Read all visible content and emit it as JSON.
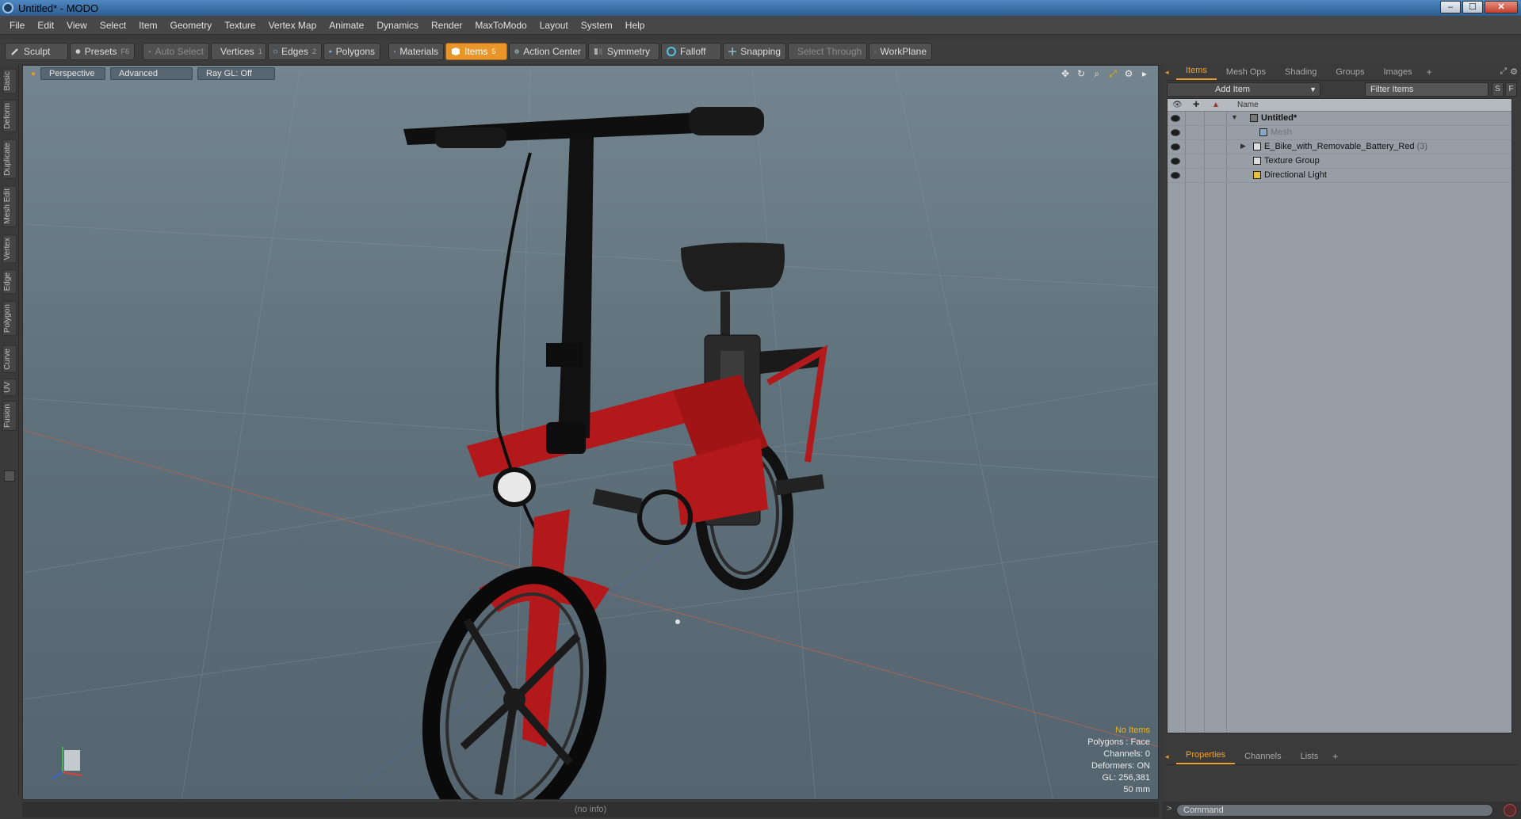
{
  "window": {
    "title": "Untitled* - MODO",
    "min": "–",
    "max": "☐",
    "close": "✕"
  },
  "menu": [
    "File",
    "Edit",
    "View",
    "Select",
    "Item",
    "Geometry",
    "Texture",
    "Vertex Map",
    "Animate",
    "Dynamics",
    "Render",
    "MaxToModo",
    "Layout",
    "System",
    "Help"
  ],
  "toolbar": {
    "sculpt": "Sculpt",
    "presets": "Presets",
    "presets_key": "F6",
    "auto_select": "Auto Select",
    "vertices": "Vertices",
    "vertices_key": "1",
    "edges": "Edges",
    "edges_key": "2",
    "polygons": "Polygons",
    "materials": "Materials",
    "items": "Items",
    "items_key": "5",
    "action_center": "Action Center",
    "symmetry": "Symmetry",
    "falloff": "Falloff",
    "snapping": "Snapping",
    "select_through": "Select Through",
    "workplane": "WorkPlane"
  },
  "left_tabs": [
    "Basic",
    "Deform",
    "Duplicate",
    "Mesh Edit",
    "Vertex",
    "Edge",
    "Polygon",
    "Curve",
    "UV",
    "Fusion"
  ],
  "viewport": {
    "view": "Perspective",
    "mode": "Advanced",
    "raygl": "Ray GL: Off",
    "info": {
      "selection": "No Items",
      "polygons": "Polygons : Face",
      "channels": "Channels: 0",
      "deformers": "Deformers: ON",
      "gl": "GL: 256,381",
      "scale": "50 mm"
    }
  },
  "status": "(no info)",
  "panel_top": {
    "tabs": [
      "Items",
      "Mesh Ops",
      "Shading",
      "Groups",
      "Images"
    ],
    "plus": "+",
    "add_item": "Add Item",
    "filter": "Filter Items",
    "btn_s": "S",
    "btn_f": "F",
    "column_name": "Name",
    "tree": [
      {
        "label": "Untitled*",
        "count": ""
      },
      {
        "label": "Mesh",
        "count": ""
      },
      {
        "label": "E_Bike_with_Removable_Battery_Red",
        "count": "(3)"
      },
      {
        "label": "Texture Group",
        "count": ""
      },
      {
        "label": "Directional Light",
        "count": ""
      }
    ]
  },
  "panel_bottom": {
    "tabs": [
      "Properties",
      "Channels",
      "Lists"
    ],
    "plus": "+"
  },
  "command": {
    "placeholder": "Command",
    "prompt": ">"
  },
  "colors": {
    "accent": "#e8962a",
    "viewport_bg": "#5f717b",
    "bike_frame": "#b3181a"
  }
}
